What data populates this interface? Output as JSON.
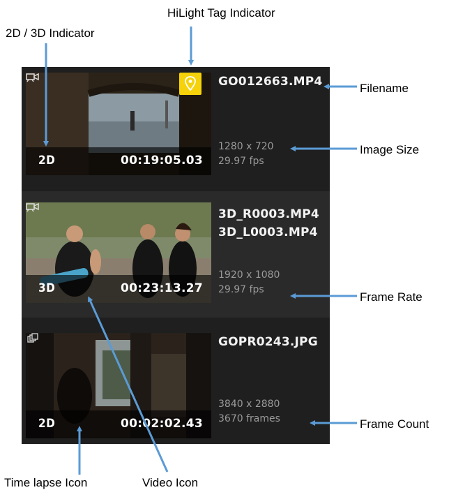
{
  "annotations": {
    "hilight_tag_indicator": "HiLight Tag Indicator",
    "dimension_indicator": "2D / 3D Indicator",
    "filename": "Filename",
    "image_size": "Image Size",
    "frame_rate": "Frame Rate",
    "frame_count": "Frame Count",
    "time_lapse_icon": "Time lapse Icon",
    "video_icon": "Video Icon"
  },
  "media_list": [
    {
      "filenames": [
        "GO012663.MP4"
      ],
      "dimension": "2D",
      "type_icon": "video-icon",
      "duration": "00:19:05.03",
      "size": "1280 x 720",
      "detail": "29.97 fps",
      "hilight": true
    },
    {
      "filenames": [
        "3D_R0003.MP4",
        "3D_L0003.MP4"
      ],
      "dimension": "3D",
      "type_icon": "video-icon",
      "duration": "00:23:13.27",
      "size": "1920 x 1080",
      "detail": "29.97 fps",
      "hilight": false
    },
    {
      "filenames": [
        "GOPR0243.JPG"
      ],
      "dimension": "2D",
      "type_icon": "time-lapse-icon",
      "duration": "00:02:02.43",
      "size": "3840 x 2880",
      "detail": "3670 frames",
      "hilight": false
    }
  ],
  "colors": {
    "panel_bg": "#1f1f1f",
    "selected_row_bg": "#2a2a2a",
    "hilight_badge": "#f5d20a",
    "callout_arrow": "#5b9bd5",
    "meta_text": "#9a9a9a"
  }
}
